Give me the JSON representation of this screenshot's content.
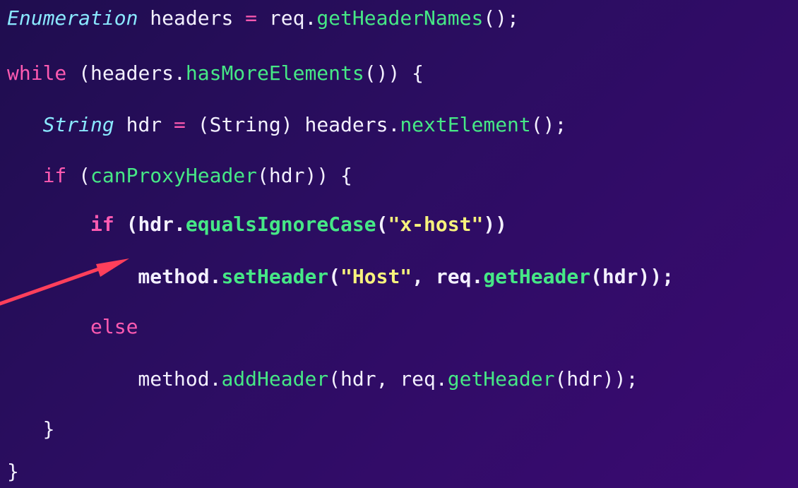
{
  "code": {
    "lines": [
      {
        "tokens": [
          {
            "type": "type",
            "text": "Enumeration"
          },
          {
            "type": "plain",
            "text": " headers "
          },
          {
            "type": "kw",
            "text": "="
          },
          {
            "type": "plain",
            "text": " req."
          },
          {
            "type": "fn",
            "text": "getHeaderNames"
          },
          {
            "type": "plain",
            "text": "();"
          }
        ]
      },
      {
        "tokens": [
          {
            "type": "kw",
            "text": "while"
          },
          {
            "type": "plain",
            "text": " (headers."
          },
          {
            "type": "fn",
            "text": "hasMoreElements"
          },
          {
            "type": "plain",
            "text": "()) {"
          }
        ]
      },
      {
        "tokens": [
          {
            "type": "plain",
            "text": "   "
          },
          {
            "type": "type",
            "text": "String"
          },
          {
            "type": "plain",
            "text": " hdr "
          },
          {
            "type": "kw",
            "text": "="
          },
          {
            "type": "plain",
            "text": " (String) headers."
          },
          {
            "type": "fn",
            "text": "nextElement"
          },
          {
            "type": "plain",
            "text": "();"
          }
        ]
      },
      {
        "tokens": [
          {
            "type": "plain",
            "text": "   "
          },
          {
            "type": "kw",
            "text": "if"
          },
          {
            "type": "plain",
            "text": " ("
          },
          {
            "type": "fn",
            "text": "canProxyHeader"
          },
          {
            "type": "plain",
            "text": "(hdr)) {"
          }
        ]
      },
      {
        "bold": true,
        "tokens": [
          {
            "type": "plain",
            "text": "       "
          },
          {
            "type": "kw",
            "text": "if"
          },
          {
            "type": "plain",
            "text": " (hdr."
          },
          {
            "type": "fn",
            "text": "equalsIgnoreCase"
          },
          {
            "type": "plain",
            "text": "("
          },
          {
            "type": "str",
            "text": "\"x-host\""
          },
          {
            "type": "plain",
            "text": "))"
          }
        ]
      },
      {
        "bold": true,
        "tokens": [
          {
            "type": "plain",
            "text": "           method."
          },
          {
            "type": "fn",
            "text": "setHeader"
          },
          {
            "type": "plain",
            "text": "("
          },
          {
            "type": "str",
            "text": "\"Host\""
          },
          {
            "type": "plain",
            "text": ", req."
          },
          {
            "type": "fn",
            "text": "getHeader"
          },
          {
            "type": "plain",
            "text": "(hdr));"
          }
        ]
      },
      {
        "tokens": [
          {
            "type": "plain",
            "text": "       "
          },
          {
            "type": "kw",
            "text": "else"
          }
        ]
      },
      {
        "tokens": [
          {
            "type": "plain",
            "text": "           method."
          },
          {
            "type": "fn",
            "text": "addHeader"
          },
          {
            "type": "plain",
            "text": "(hdr, req."
          },
          {
            "type": "fn",
            "text": "getHeader"
          },
          {
            "type": "plain",
            "text": "(hdr));"
          }
        ]
      },
      {
        "tokens": [
          {
            "type": "plain",
            "text": "   }"
          }
        ]
      },
      {
        "tokens": [
          {
            "type": "plain",
            "text": "}"
          }
        ]
      }
    ]
  },
  "colors": {
    "background_start": "#1f0d4f",
    "background_end": "#3b0a72",
    "keyword": "#ff5ab1",
    "type": "#8ae8ff",
    "function": "#46e886",
    "string": "#f7f27c",
    "text": "#f3f0ff",
    "arrow": "#ff3f5b"
  },
  "icons": {
    "annotation": "arrow-icon"
  }
}
